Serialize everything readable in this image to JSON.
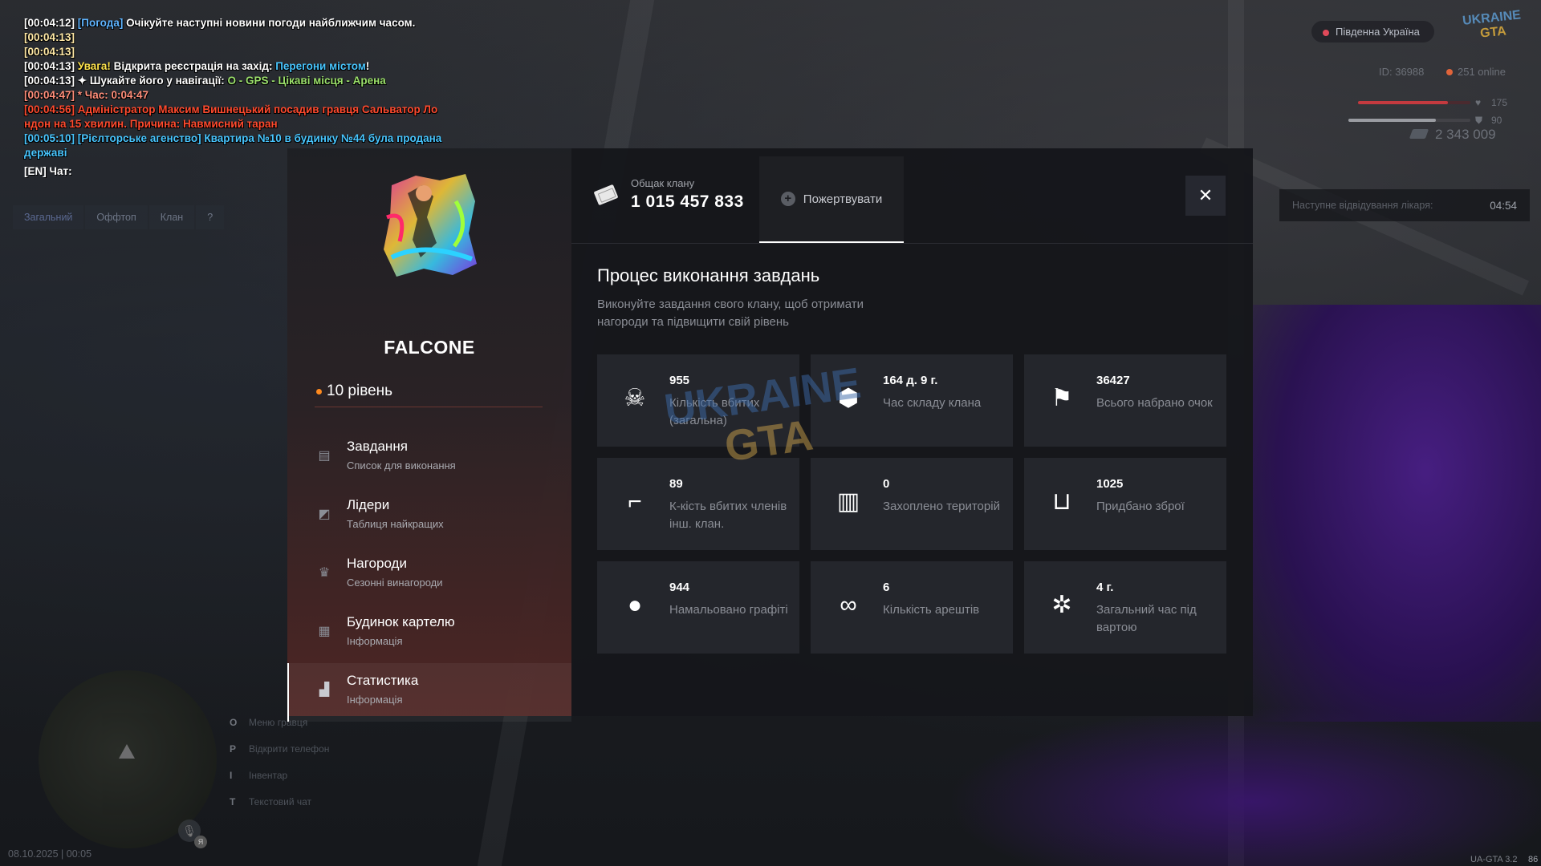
{
  "chat": {
    "lines": [
      {
        "ts": "[00:04:12]",
        "tag": "[Погода]",
        "text": " Очікуйте наступні новини погоди найближчим часом."
      },
      {
        "ts": "[00:04:13]"
      },
      {
        "ts": "[00:04:13]"
      },
      {
        "ts": "[00:04:13]",
        "warn": " Увага!",
        "text": " Відкрита реєстрація на захід: ",
        "event": "Перегони містом",
        "end": "!"
      },
      {
        "ts": "[00:04:13]",
        "text": " ✦  Шукайте його у навігації: ",
        "path": "O - GPS - Цікаві місця - Арена"
      },
      {
        "ts": "[00:04:47]",
        "text": " * Час: 0:04:47"
      },
      {
        "ts": "[00:04:56]",
        "text": " Адміністратор Максим Вишнецький посадив гравця Сальватор Ло",
        "text2": "ндон на 15 хвилин. Причина: Навмисний таран"
      },
      {
        "ts": "[00:05:10]",
        "text": " [Рієлторське агенство] Квартира №10 в будинку №44 була продана",
        "text2": " державі"
      }
    ],
    "input": "[EN] Чат:",
    "tabs": [
      "Загальний",
      "Оффтоп",
      "Клан",
      "?"
    ]
  },
  "hud": {
    "region": "Південна Україна",
    "logo_top": "UKRAINE",
    "logo_bottom": "GTA",
    "id": "ID: 36988",
    "online": "251 online",
    "health": "175",
    "armor": "90",
    "health_fraction": 0.8,
    "armor_fraction": 0.72,
    "money": "2 343 009",
    "hospital_label": "Наступне відвідування лікаря:",
    "hospital_time": "04:54",
    "keys": [
      {
        "key": "O",
        "label": "Меню гравця"
      },
      {
        "key": "P",
        "label": "Відкрити телефон"
      },
      {
        "key": "I",
        "label": "Інвентар"
      },
      {
        "key": "T",
        "label": "Текстовий чат"
      }
    ],
    "mic_badge": "Я",
    "datetime": "08.10.2025 | 00:05",
    "version": "UA-GTA 3.2",
    "fps": "86"
  },
  "sidebar": {
    "clan_name": "FALCONE",
    "level": "10 рівень",
    "menu": [
      {
        "title": "Завдання",
        "sub": "Список для виконання",
        "icon": "list-icon"
      },
      {
        "title": "Лідери",
        "sub": "Таблиця найкращих",
        "icon": "chart-icon"
      },
      {
        "title": "Нагороди",
        "sub": "Сезонні винагороди",
        "icon": "trophy-icon"
      },
      {
        "title": "Будинок картелю",
        "sub": "Інформація",
        "icon": "building-icon"
      },
      {
        "title": "Статистика",
        "sub": "Інформація",
        "icon": "stats-icon"
      }
    ]
  },
  "header": {
    "bank_label": "Общак клану",
    "bank_value": "1 015 457 833",
    "donate_label": "Пожертвувати",
    "close_icon": "close-icon"
  },
  "main": {
    "title": "Процес виконання завдань",
    "description": "Виконуйте завдання свого клану, щоб отримати нагороди та підвищити свій рівень",
    "stats": [
      {
        "value": "955",
        "label": "Кількість вбитих (загальна)",
        "icon": "skull-icon",
        "glyph": "☠"
      },
      {
        "value": "164 д. 9 г.",
        "label": "Час складу клана",
        "icon": "box-clock-icon",
        "glyph": "⬢"
      },
      {
        "value": "36427",
        "label": "Всього набрано очок",
        "icon": "flag-icon",
        "glyph": "⚑"
      },
      {
        "value": "89",
        "label": "К-кість вбитих членів інш. клан.",
        "icon": "rifle-icon",
        "glyph": "⌐"
      },
      {
        "value": "0",
        "label": "Захоплено територій",
        "icon": "map-icon",
        "glyph": "▥"
      },
      {
        "value": "1025",
        "label": "Придбано зброї",
        "icon": "basket-icon",
        "glyph": "⊔"
      },
      {
        "value": "944",
        "label": "Намальовано графіті",
        "icon": "spray-drip-icon",
        "glyph": "●"
      },
      {
        "value": "6",
        "label": "Кількість арештів",
        "icon": "handcuffs-icon",
        "glyph": "∞"
      },
      {
        "value": "4 г.",
        "label": "Загальний час під вартою",
        "icon": "jail-icon",
        "glyph": "✲"
      }
    ]
  },
  "watermark": {
    "top": "UKRAINE",
    "bottom": "GTA"
  }
}
